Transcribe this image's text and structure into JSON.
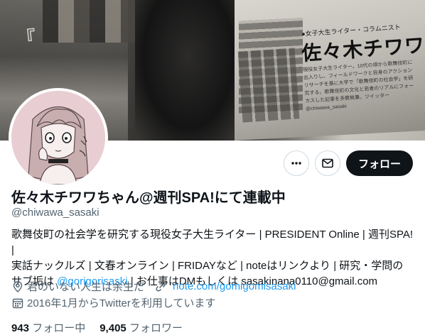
{
  "banner": {
    "headline": "佐々木チワワ",
    "label": "●女子大生ライター・コラムニスト",
    "body": "現役女子大生ライター。10代の頃から歌舞伎町に出入りし、フィールドワークと自身のアクションリサーチを基に大学で「歌舞伎町の社会学」を研究する。歌舞伎町の文化と若者のリアルにフォーカスした記事を多数執筆。ツイッター@chiwawa_sasaki"
  },
  "actions": {
    "more_icon": "more-icon",
    "message_icon": "mail-icon",
    "follow_label": "フォロー"
  },
  "profile": {
    "name": "佐々木チワワちゃん@週刊SPA!にて連載中",
    "handle": "@chiwawa_sasaki",
    "bio_line1": "歌舞伎町の社会学を研究する現役女子大生ライター | PRESIDENT Online | 週刊SPA! |",
    "bio_line2": "実話ナックルズ | 文春オンライン | FRIDAYなど | noteはリンクより | 研究・学問の",
    "bio_line3_pre": "サブ垢は ",
    "bio_mention": "@gorigorisaski",
    "bio_line3_post": " | お仕事はDMもしくは sasakinana0110@gmail.com",
    "location": "君のいない人生は余生だ",
    "url": "note.com/gomigomisasaki",
    "joined": "2016年1月からTwitterを利用しています"
  },
  "stats": {
    "following_count": "943",
    "following_label": "フォロー中",
    "followers_count": "9,405",
    "followers_label": "フォロワー"
  },
  "colors": {
    "accent": "#1d9bf0",
    "text": "#0f1419",
    "secondary": "#536471",
    "follow_bg": "#0f1419",
    "avatar_bg": "#e8ced3"
  }
}
